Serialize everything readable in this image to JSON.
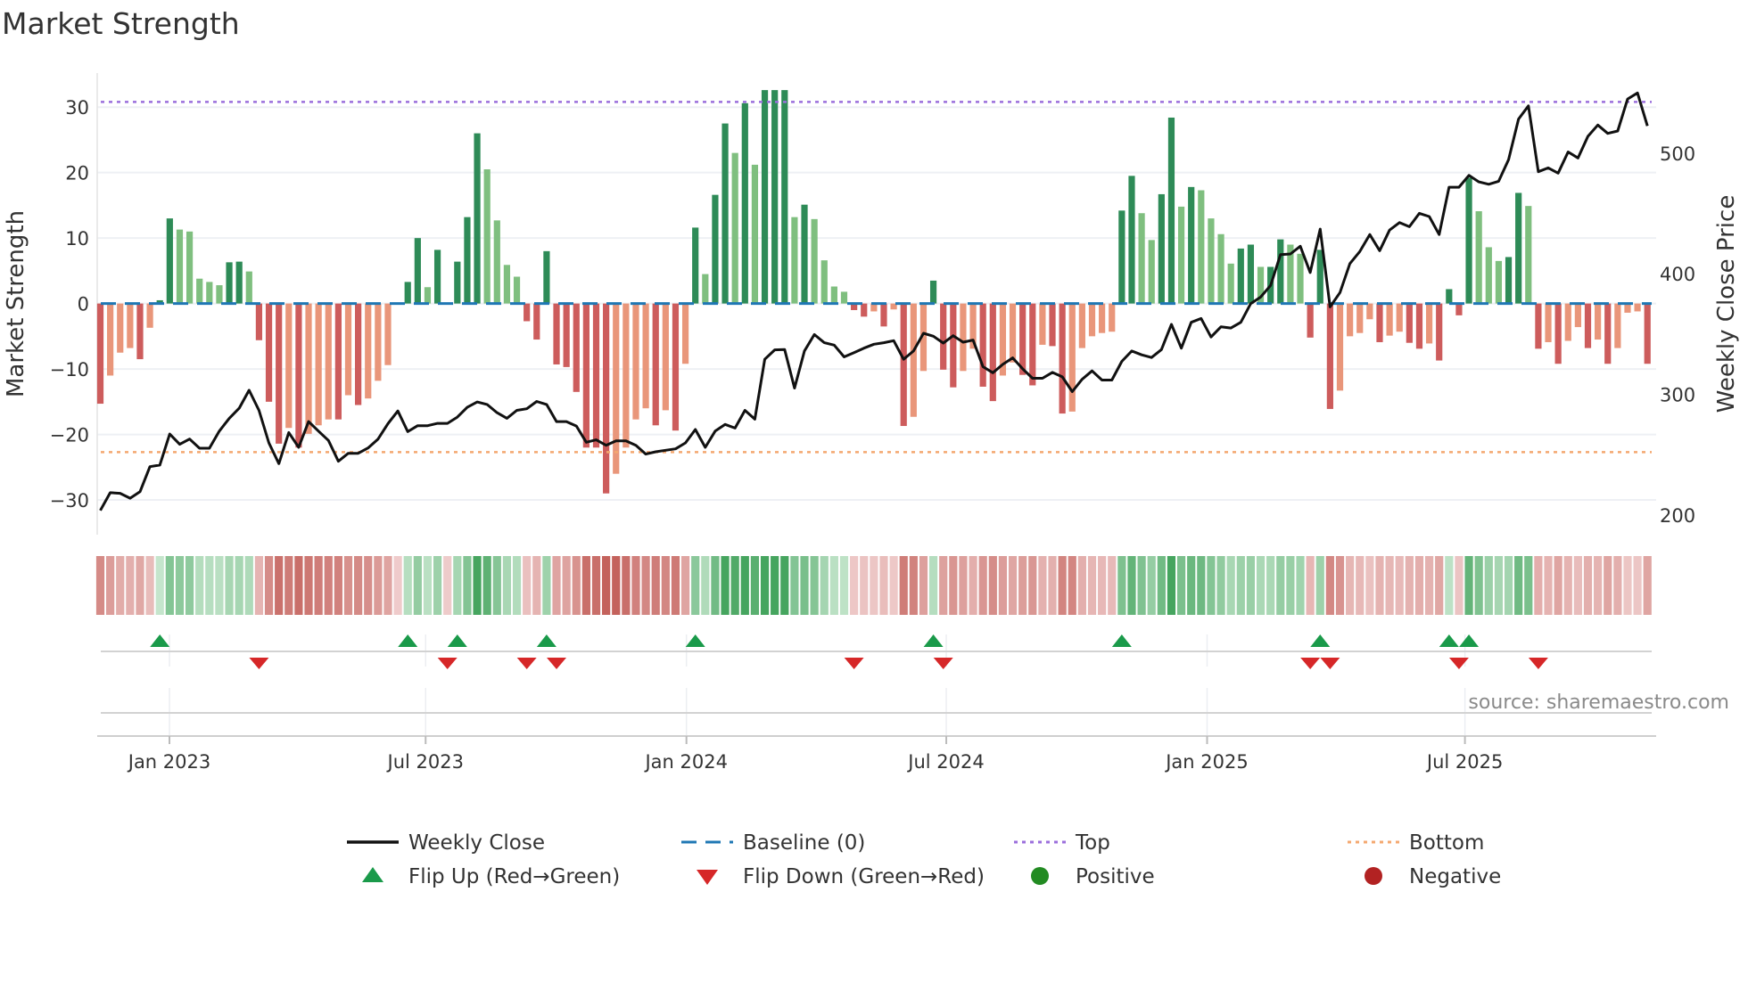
{
  "chart_data": {
    "type": "bar",
    "title": "Market Strength",
    "ylabel": "Market Strength",
    "y2label": "Weekly Close Price",
    "ylim": [
      -35.3,
      35.2
    ],
    "y2lim": [
      183.6,
      566.4
    ],
    "yticks": [
      30,
      20,
      10,
      0,
      -10,
      -20,
      -30
    ],
    "ytick_labels": [
      "30",
      "20",
      "10",
      "0",
      "−10",
      "−20",
      "−30"
    ],
    "y2ticks": [
      500,
      400,
      300,
      200
    ],
    "y2tick_labels": [
      "500",
      "400",
      "300",
      "200"
    ],
    "xticks": [
      {
        "week": 6.97,
        "label": "Jan 2023"
      },
      {
        "week": 32.8,
        "label": "Jul 2023"
      },
      {
        "week": 59.1,
        "label": "Jan 2024"
      },
      {
        "week": 85.3,
        "label": "Jul 2024"
      },
      {
        "week": 111.6,
        "label": "Jan 2025"
      },
      {
        "week": 137.6,
        "label": "Jul 2025"
      }
    ],
    "top_level": 30.8,
    "bottom_level": -22.7,
    "baseline": 0,
    "strength": [
      -15.3,
      -11,
      -7.5,
      -6.8,
      -8.5,
      -3.7,
      0.5,
      13,
      11.3,
      11,
      3.8,
      3.3,
      2.8,
      6.3,
      6.4,
      4.9,
      -5.6,
      -15,
      -21.4,
      -19,
      -22,
      -19.9,
      -18.6,
      -17.7,
      -17.7,
      -14,
      -15.5,
      -14.5,
      -11.8,
      -9.4,
      0,
      3.3,
      10,
      2.5,
      8.2,
      -0.1,
      6.4,
      13.2,
      26,
      20.5,
      12.7,
      5.9,
      4.1,
      -2.7,
      -5.5,
      8,
      -9.3,
      -9.7,
      -13.5,
      -22,
      -22,
      -29,
      -26,
      -22,
      -17.7,
      -16,
      -18.6,
      -16.3,
      -19.4,
      -9.2,
      11.6,
      4.5,
      16.6,
      27.5,
      23,
      30.6,
      21.2,
      32.6,
      32.6,
      32.6,
      13.2,
      15.1,
      12.9,
      6.6,
      2.6,
      1.8,
      -1,
      -2,
      -1.2,
      -3.5,
      -0.9,
      -18.7,
      -17.3,
      -10.3,
      3.5,
      -10.1,
      -12.8,
      -10.3,
      -6.9,
      -12.7,
      -14.9,
      -11,
      -9,
      -10.9,
      -12.5,
      -6.3,
      -6.5,
      -16.8,
      -16.5,
      -6.8,
      -5,
      -4.5,
      -4.3,
      14.2,
      19.5,
      13.8,
      9.7,
      16.7,
      28.4,
      14.8,
      17.8,
      17.3,
      13,
      10.6,
      6.1,
      8.4,
      9,
      5.6,
      5.6,
      9.8,
      9,
      7.6,
      -5.2,
      8.2,
      -16.1,
      -13.3,
      -5,
      -4.5,
      -2.4,
      -5.9,
      -4.9,
      -4.3,
      -6,
      -6.9,
      -6.1,
      -8.7,
      2.2,
      -1.8,
      19.2,
      14.1,
      8.6,
      6.5,
      7.1,
      16.9,
      14.9,
      -6.9,
      -5.9,
      -9.2,
      -5.7,
      -3.6,
      -6.8,
      -5.5,
      -9.2,
      -6.8,
      -1.4,
      -1.2,
      -9.2
    ],
    "weekly_close": [
      203.7,
      218.4,
      217.9,
      213.8,
      219.2,
      240,
      241.3,
      267,
      258.5,
      262.9,
      255.3,
      255.3,
      269.5,
      280.1,
      288.5,
      303.4,
      286.7,
      259.7,
      242.5,
      268.3,
      256,
      277.4,
      269.5,
      261.7,
      244.5,
      251.1,
      251.1,
      255.5,
      262.9,
      275.7,
      286.2,
      269,
      274,
      274,
      275.9,
      275.9,
      281.1,
      289.2,
      293.6,
      291.6,
      284.8,
      280.1,
      286.7,
      288,
      294.1,
      291.6,
      277.4,
      277.4,
      273.7,
      260.2,
      262.2,
      257.7,
      261.4,
      261.4,
      257.7,
      250.4,
      252.3,
      253.6,
      254.8,
      259.7,
      270.8,
      256,
      269.5,
      275,
      272,
      286.7,
      279.4,
      329,
      336.9,
      337.1,
      305.2,
      335.9,
      349.6,
      342.8,
      340.8,
      331,
      334.6,
      338.3,
      341.5,
      342.8,
      344.5,
      329,
      335.9,
      350.6,
      348.2,
      342.5,
      348.6,
      343.2,
      345,
      322.9,
      317.9,
      324.8,
      330.2,
      321.1,
      313.3,
      313.3,
      318.2,
      314.5,
      302.2,
      312.5,
      319.4,
      311.8,
      311.8,
      327.3,
      335.9,
      332.7,
      330.5,
      337.1,
      358,
      338.3,
      359.7,
      362.9,
      347.5,
      356,
      355,
      359.7,
      375.2,
      380.6,
      390.3,
      415.9,
      416.4,
      422.8,
      401,
      437,
      372.5,
      384.4,
      408.4,
      418.4,
      432.5,
      419.1,
      436.2,
      442.4,
      439,
      450.1,
      447.4,
      432.5,
      471.7,
      471.7,
      481.6,
      476.2,
      474.2,
      476.7,
      494.5,
      528.3,
      539.2,
      484.6,
      487.8,
      483.4,
      501,
      496,
      513.9,
      523.3,
      516.4,
      518.4,
      544.9,
      549.9,
      522.6
    ],
    "legend": {
      "placement": "bottom-center",
      "entries": [
        {
          "label": "Weekly Close",
          "kind": "line",
          "color": "#111111"
        },
        {
          "label": "Baseline (0)",
          "kind": "dashed",
          "color": "#1f77b4"
        },
        {
          "label": "Top",
          "kind": "dotted",
          "color": "#9b6fdc"
        },
        {
          "label": "Bottom",
          "kind": "dotted",
          "color": "#f4a870"
        },
        {
          "label": "Flip Up (Red→Green)",
          "kind": "triangle-up",
          "color": "#1a9a4a"
        },
        {
          "label": "Flip Down (Green→Red)",
          "kind": "triangle-down",
          "color": "#d62728"
        },
        {
          "label": "Positive",
          "kind": "dot",
          "color": "#228b22"
        },
        {
          "label": "Negative",
          "kind": "dot",
          "color": "#b22222"
        }
      ]
    },
    "colors": {
      "pos_strong": "#2e8b57",
      "pos_weak": "#7fbf7f",
      "neg_strong": "#cd5c5c",
      "neg_weak": "#e9967a",
      "baseline": "#1f77b4",
      "top": "#9b6fdc",
      "bottom": "#f4a870",
      "flip_up": "#1a9a4a",
      "flip_down": "#d62728",
      "price": "#111111"
    },
    "source": "source: sharemaestro.com"
  }
}
